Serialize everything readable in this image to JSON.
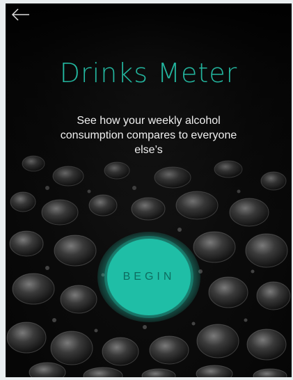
{
  "header": {
    "back_icon": "arrow-left-icon"
  },
  "main": {
    "title": "Drinks Meter",
    "subtitle": "See how your weekly alcohol consumption compares to everyone else’s",
    "begin_label": "BEGIN"
  },
  "colors": {
    "accent": "#23b59e",
    "button": "#1fbea6",
    "background": "#0c0c0c",
    "text": "#f0f0f0"
  }
}
